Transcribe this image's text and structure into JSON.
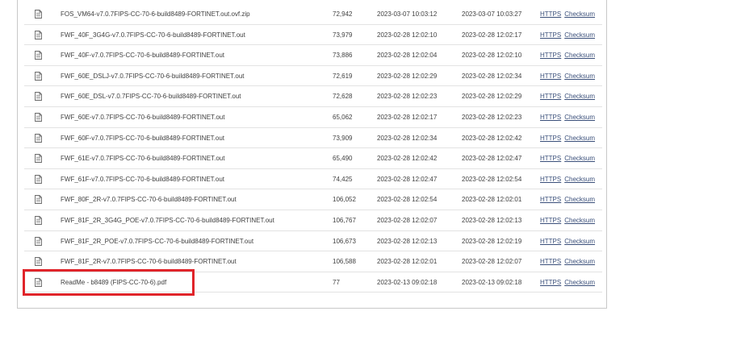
{
  "files": [
    {
      "name": "FOS_VM64-v7.0.7FIPS-CC-70-6-build8489-FORTINET.out.ovf.zip",
      "size": "72,942",
      "created": "2023-03-07 10:03:12",
      "modified": "2023-03-07 10:03:27"
    },
    {
      "name": "FWF_40F_3G4G-v7.0.7FIPS-CC-70-6-build8489-FORTINET.out",
      "size": "73,979",
      "created": "2023-02-28 12:02:10",
      "modified": "2023-02-28 12:02:17"
    },
    {
      "name": "FWF_40F-v7.0.7FIPS-CC-70-6-build8489-FORTINET.out",
      "size": "73,886",
      "created": "2023-02-28 12:02:04",
      "modified": "2023-02-28 12:02:10"
    },
    {
      "name": "FWF_60E_DSLJ-v7.0.7FIPS-CC-70-6-build8489-FORTINET.out",
      "size": "72,619",
      "created": "2023-02-28 12:02:29",
      "modified": "2023-02-28 12:02:34"
    },
    {
      "name": "FWF_60E_DSL-v7.0.7FIPS-CC-70-6-build8489-FORTINET.out",
      "size": "72,628",
      "created": "2023-02-28 12:02:23",
      "modified": "2023-02-28 12:02:29"
    },
    {
      "name": "FWF_60E-v7.0.7FIPS-CC-70-6-build8489-FORTINET.out",
      "size": "65,062",
      "created": "2023-02-28 12:02:17",
      "modified": "2023-02-28 12:02:23"
    },
    {
      "name": "FWF_60F-v7.0.7FIPS-CC-70-6-build8489-FORTINET.out",
      "size": "73,909",
      "created": "2023-02-28 12:02:34",
      "modified": "2023-02-28 12:02:42"
    },
    {
      "name": "FWF_61E-v7.0.7FIPS-CC-70-6-build8489-FORTINET.out",
      "size": "65,490",
      "created": "2023-02-28 12:02:42",
      "modified": "2023-02-28 12:02:47"
    },
    {
      "name": "FWF_61F-v7.0.7FIPS-CC-70-6-build8489-FORTINET.out",
      "size": "74,425",
      "created": "2023-02-28 12:02:47",
      "modified": "2023-02-28 12:02:54"
    },
    {
      "name": "FWF_80F_2R-v7.0.7FIPS-CC-70-6-build8489-FORTINET.out",
      "size": "106,052",
      "created": "2023-02-28 12:02:54",
      "modified": "2023-02-28 12:02:01"
    },
    {
      "name": "FWF_81F_2R_3G4G_POE-v7.0.7FIPS-CC-70-6-build8489-FORTINET.out",
      "size": "106,767",
      "created": "2023-02-28 12:02:07",
      "modified": "2023-02-28 12:02:13"
    },
    {
      "name": "FWF_81F_2R_POE-v7.0.7FIPS-CC-70-6-build8489-FORTINET.out",
      "size": "106,673",
      "created": "2023-02-28 12:02:13",
      "modified": "2023-02-28 12:02:19"
    },
    {
      "name": "FWF_81F_2R-v7.0.7FIPS-CC-70-6-build8489-FORTINET.out",
      "size": "106,588",
      "created": "2023-02-28 12:02:01",
      "modified": "2023-02-28 12:02:07"
    },
    {
      "name": "ReadMe - b8489 (FIPS-CC-70-6).pdf",
      "size": "77",
      "created": "2023-02-13 09:02:18",
      "modified": "2023-02-13 09:02:18"
    }
  ],
  "links": {
    "https": "HTTPS",
    "checksum": "Checksum"
  },
  "icons": {
    "file": "document-icon"
  },
  "colors": {
    "highlight": "#e0242a",
    "link": "#3a4f7a"
  }
}
